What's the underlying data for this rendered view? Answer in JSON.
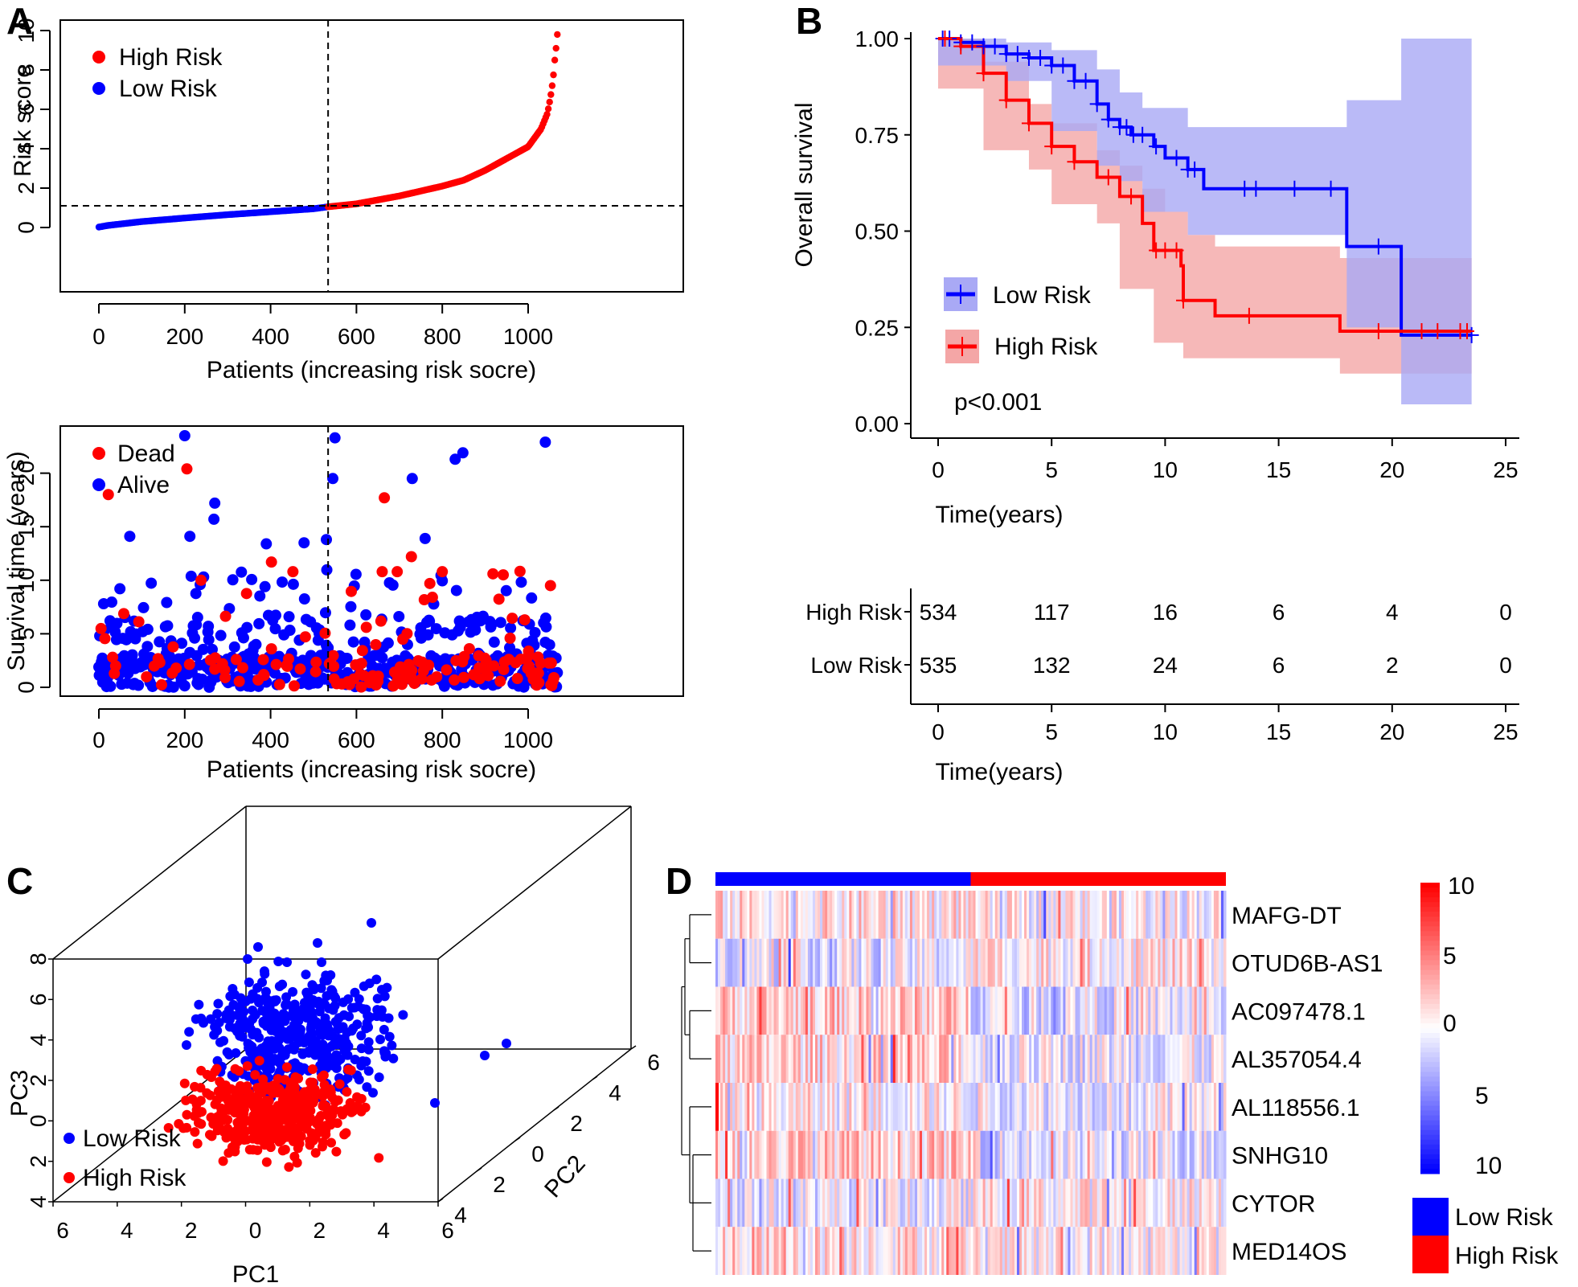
{
  "colors": {
    "high": "#ff0000",
    "low": "#0000ff",
    "high_band": "#f4a6a6",
    "low_band": "#a9a9f5",
    "axis": "#000000"
  },
  "panels": {
    "A": "A",
    "B": "B",
    "C": "C",
    "D": "D"
  },
  "chart_data": [
    {
      "id": "A-top",
      "type": "scatter",
      "title": "",
      "xlabel": "Patients (increasing risk socre)",
      "ylabel": "Risk score",
      "xlim": [
        0,
        1069
      ],
      "ylim": [
        0,
        10
      ],
      "xticks": [
        0,
        200,
        400,
        600,
        800,
        1000
      ],
      "yticks": [
        0,
        2,
        4,
        6,
        8,
        10
      ],
      "cutoff_patient": 534,
      "cutoff_risk": 1.1,
      "legend": [
        {
          "label": "High Risk",
          "color": "#ff0000"
        },
        {
          "label": "Low Risk",
          "color": "#0000ff"
        }
      ],
      "legend_position": "top-left",
      "curve_points": [
        [
          0,
          0.02
        ],
        [
          20,
          0.1
        ],
        [
          100,
          0.3
        ],
        [
          200,
          0.48
        ],
        [
          300,
          0.65
        ],
        [
          400,
          0.8
        ],
        [
          500,
          0.95
        ],
        [
          534,
          1.05
        ],
        [
          600,
          1.2
        ],
        [
          700,
          1.6
        ],
        [
          800,
          2.1
        ],
        [
          850,
          2.4
        ],
        [
          900,
          2.9
        ],
        [
          950,
          3.5
        ],
        [
          1000,
          4.1
        ],
        [
          1030,
          5.0
        ],
        [
          1045,
          5.8
        ],
        [
          1052,
          6.6
        ],
        [
          1058,
          7.5
        ],
        [
          1062,
          8.5
        ],
        [
          1065,
          9.1
        ],
        [
          1067,
          9.6
        ],
        [
          1069,
          10.0
        ]
      ],
      "series": [
        {
          "name": "Low Risk",
          "range": [
            0,
            533
          ]
        },
        {
          "name": "High Risk",
          "range": [
            534,
            1069
          ]
        }
      ]
    },
    {
      "id": "A-bottom",
      "type": "scatter",
      "title": "",
      "xlabel": "Patients (increasing risk socre)",
      "ylabel": "Survival time (years)",
      "xlim": [
        0,
        1069
      ],
      "ylim": [
        0,
        23.5
      ],
      "xticks": [
        0,
        200,
        400,
        600,
        800,
        1000
      ],
      "yticks": [
        0,
        5,
        10,
        15,
        20
      ],
      "cutoff_patient": 534,
      "legend": [
        {
          "label": "Dead",
          "color": "#ff0000"
        },
        {
          "label": "Alive",
          "color": "#0000ff"
        }
      ],
      "legend_position": "top-left",
      "notable_points": [
        {
          "x": 200,
          "y": 23.5,
          "status": "Alive"
        },
        {
          "x": 205,
          "y": 20.4,
          "status": "Dead"
        },
        {
          "x": 22,
          "y": 18.0,
          "status": "Dead"
        },
        {
          "x": 270,
          "y": 17.2,
          "status": "Alive"
        },
        {
          "x": 268,
          "y": 15.7,
          "status": "Alive"
        },
        {
          "x": 72,
          "y": 14.1,
          "status": "Alive"
        },
        {
          "x": 212,
          "y": 14.1,
          "status": "Alive"
        },
        {
          "x": 390,
          "y": 13.4,
          "status": "Alive"
        },
        {
          "x": 478,
          "y": 13.5,
          "status": "Alive"
        },
        {
          "x": 530,
          "y": 13.8,
          "status": "Alive"
        },
        {
          "x": 550,
          "y": 23.3,
          "status": "Alive"
        },
        {
          "x": 545,
          "y": 19.5,
          "status": "Alive"
        },
        {
          "x": 665,
          "y": 17.7,
          "status": "Dead"
        },
        {
          "x": 730,
          "y": 19.5,
          "status": "Alive"
        },
        {
          "x": 760,
          "y": 13.9,
          "status": "Alive"
        },
        {
          "x": 830,
          "y": 21.3,
          "status": "Alive"
        },
        {
          "x": 848,
          "y": 21.9,
          "status": "Alive"
        },
        {
          "x": 1040,
          "y": 22.9,
          "status": "Alive"
        },
        {
          "x": 728,
          "y": 12.2,
          "status": "Dead"
        },
        {
          "x": 402,
          "y": 11.7,
          "status": "Dead"
        },
        {
          "x": 452,
          "y": 10.8,
          "status": "Dead"
        },
        {
          "x": 238,
          "y": 10.0,
          "status": "Dead"
        },
        {
          "x": 660,
          "y": 10.8,
          "status": "Dead"
        },
        {
          "x": 695,
          "y": 10.8,
          "status": "Dead"
        },
        {
          "x": 800,
          "y": 10.8,
          "status": "Dead"
        },
        {
          "x": 918,
          "y": 10.6,
          "status": "Dead"
        },
        {
          "x": 1052,
          "y": 9.5,
          "status": "Dead"
        }
      ]
    },
    {
      "id": "B-km",
      "type": "line",
      "title": "",
      "xlabel": "Time(years)",
      "ylabel": "Overall survival",
      "xlim": [
        0,
        25
      ],
      "ylim": [
        0,
        1
      ],
      "xticks": [
        0,
        5,
        10,
        15,
        20,
        25
      ],
      "yticks": [
        "0.00",
        "0.25",
        "0.50",
        "0.75",
        "1.00"
      ],
      "annotation": "p<0.001",
      "legend": [
        {
          "label": "Low Risk",
          "color": "#0000ff"
        },
        {
          "label": "High Risk",
          "color": "#ff0000"
        }
      ],
      "legend_position": "bottom-left",
      "series": [
        {
          "name": "Low Risk",
          "steps": [
            [
              0,
              1.0
            ],
            [
              1,
              0.99
            ],
            [
              2,
              0.98
            ],
            [
              3,
              0.96
            ],
            [
              4,
              0.95
            ],
            [
              5,
              0.93
            ],
            [
              6,
              0.89
            ],
            [
              7,
              0.83
            ],
            [
              7.5,
              0.79
            ],
            [
              8,
              0.77
            ],
            [
              8.5,
              0.75
            ],
            [
              9.5,
              0.72
            ],
            [
              10,
              0.69
            ],
            [
              11,
              0.66
            ],
            [
              11.7,
              0.61
            ],
            [
              18,
              0.61
            ],
            [
              18,
              0.46
            ],
            [
              20.4,
              0.46
            ],
            [
              20.4,
              0.23
            ],
            [
              23.5,
              0.23
            ]
          ],
          "ci_upper": [
            [
              0,
              1.0
            ],
            [
              3,
              0.99
            ],
            [
              5,
              0.97
            ],
            [
              7,
              0.92
            ],
            [
              8,
              0.86
            ],
            [
              9,
              0.82
            ],
            [
              11,
              0.77
            ],
            [
              18,
              0.77
            ],
            [
              18,
              0.84
            ],
            [
              20.4,
              0.84
            ],
            [
              20.4,
              1.0
            ],
            [
              23.5,
              1.0
            ]
          ],
          "ci_lower": [
            [
              0,
              0.99
            ],
            [
              3,
              0.93
            ],
            [
              5,
              0.89
            ],
            [
              7,
              0.76
            ],
            [
              8,
              0.67
            ],
            [
              9,
              0.63
            ],
            [
              11,
              0.55
            ],
            [
              11.7,
              0.49
            ],
            [
              18,
              0.49
            ],
            [
              18,
              0.25
            ],
            [
              20.4,
              0.25
            ],
            [
              20.4,
              0.05
            ],
            [
              23.5,
              0.05
            ]
          ]
        },
        {
          "name": "High Risk",
          "steps": [
            [
              0,
              1.0
            ],
            [
              1,
              0.98
            ],
            [
              2,
              0.91
            ],
            [
              3,
              0.84
            ],
            [
              4,
              0.78
            ],
            [
              5,
              0.72
            ],
            [
              6,
              0.68
            ],
            [
              7,
              0.64
            ],
            [
              8,
              0.59
            ],
            [
              9,
              0.52
            ],
            [
              9.5,
              0.45
            ],
            [
              10.5,
              0.45
            ],
            [
              10.7,
              0.41
            ],
            [
              10.8,
              0.32
            ],
            [
              12.2,
              0.32
            ],
            [
              12.2,
              0.28
            ],
            [
              17.7,
              0.28
            ],
            [
              17.7,
              0.24
            ],
            [
              23.5,
              0.24
            ]
          ],
          "ci_upper": [
            [
              0,
              1.0
            ],
            [
              2,
              0.94
            ],
            [
              4,
              0.83
            ],
            [
              5,
              0.78
            ],
            [
              7,
              0.71
            ],
            [
              8,
              0.67
            ],
            [
              9,
              0.61
            ],
            [
              10,
              0.55
            ],
            [
              11,
              0.49
            ],
            [
              12.2,
              0.46
            ],
            [
              17.7,
              0.46
            ],
            [
              17.7,
              0.43
            ],
            [
              23.5,
              0.43
            ]
          ],
          "ci_lower": [
            [
              0,
              0.99
            ],
            [
              2,
              0.87
            ],
            [
              4,
              0.71
            ],
            [
              5,
              0.66
            ],
            [
              7,
              0.57
            ],
            [
              8,
              0.52
            ],
            [
              9.5,
              0.35
            ],
            [
              10.8,
              0.21
            ],
            [
              12.2,
              0.17
            ],
            [
              17.7,
              0.17
            ],
            [
              17.7,
              0.13
            ],
            [
              23.5,
              0.13
            ]
          ]
        }
      ],
      "censor_marks": {
        "Low Risk": [
          0.2,
          0.5,
          1,
          1.5,
          2,
          2.5,
          3,
          3.5,
          4,
          4.5,
          5,
          5.5,
          6,
          6.5,
          7,
          7.5,
          8,
          8.3,
          8.6,
          9,
          9.6,
          10.5,
          11,
          11.3,
          13.5,
          14,
          15.7,
          17.3,
          19.4,
          23.5
        ],
        "High Risk": [
          0.3,
          1,
          2,
          3,
          4,
          5,
          6,
          7.5,
          8.5,
          9.6,
          10,
          10.5,
          10.8,
          13.7,
          19.4,
          21.3,
          22,
          23,
          23.3
        ]
      }
    },
    {
      "id": "B-risk-table",
      "type": "table",
      "xlabel": "Time(years)",
      "xticks": [
        0,
        5,
        10,
        15,
        20,
        25
      ],
      "rows": [
        {
          "label": "High Risk",
          "color": "#ff0000",
          "values": [
            534,
            117,
            16,
            6,
            4,
            0
          ]
        },
        {
          "label": "Low Risk",
          "color": "#0000ff",
          "values": [
            535,
            132,
            24,
            6,
            2,
            0
          ]
        }
      ]
    },
    {
      "id": "C-pca",
      "type": "scatter",
      "title": "",
      "xlabel": "PC1",
      "ylabel": "PC3",
      "zlabel": "PC2",
      "pc1_ticks": [
        "6",
        "4",
        "2",
        "0",
        "2",
        "4",
        "6"
      ],
      "pc3_ticks": [
        "4",
        "2",
        "0",
        "2",
        "4",
        "6",
        "8"
      ],
      "pc2_ticks": [
        "4",
        "2",
        "0",
        "2",
        "4",
        "6"
      ],
      "legend": [
        {
          "label": "Low Risk",
          "color": "#0000ff"
        },
        {
          "label": "High Risk",
          "color": "#ff0000"
        }
      ],
      "legend_position": "bottom-left"
    },
    {
      "id": "D-heatmap",
      "type": "heatmap",
      "genes": [
        "MAFG-DT",
        "OTUD6B-AS1",
        "AC097478.1",
        "AL357054.4",
        "AL118556.1",
        "SNHG10",
        "CYTOR",
        "MED14OS"
      ],
      "column_groups": [
        {
          "label": "Low Risk",
          "color": "#0000ff",
          "fraction": 0.5
        },
        {
          "label": "High Risk",
          "color": "#ff0000",
          "fraction": 0.5
        }
      ],
      "colorbar_ticks": [
        "10",
        "5",
        "0",
        "5",
        "10"
      ],
      "colorbar_range": [
        -10,
        10
      ],
      "gene_bias_low_group": [
        0.25,
        -0.15,
        0.45,
        0.35,
        0.1,
        0.45,
        -0.1,
        0.3
      ],
      "gene_bias_high_group": [
        0.05,
        0.2,
        -0.15,
        -0.1,
        -0.05,
        -0.2,
        0.15,
        0.05
      ],
      "legend": [
        {
          "label": "Low Risk",
          "color": "#0000ff"
        },
        {
          "label": "High Risk",
          "color": "#ff0000"
        }
      ]
    }
  ]
}
